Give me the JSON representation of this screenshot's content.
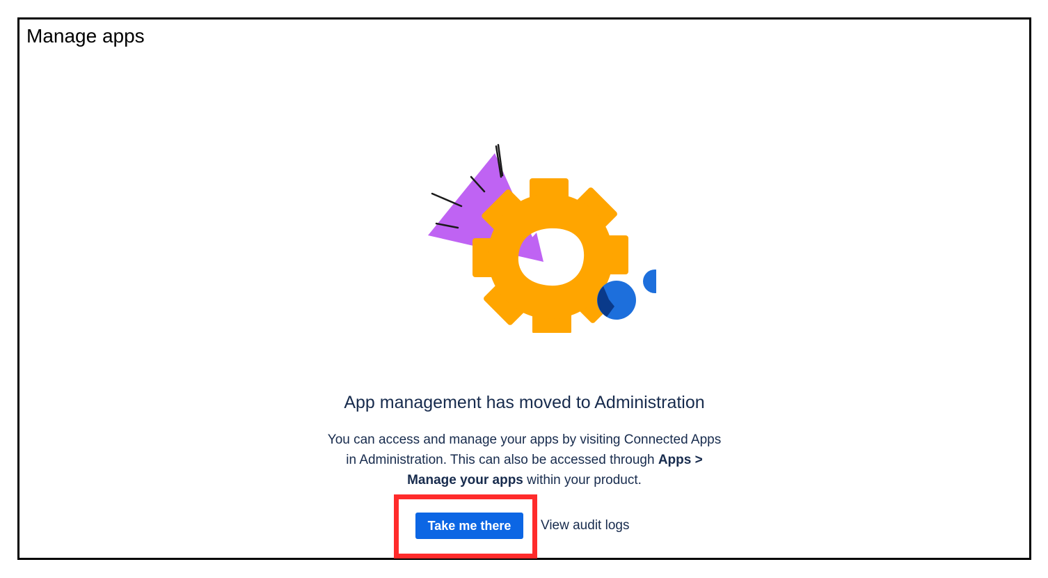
{
  "page": {
    "title": "Manage apps"
  },
  "main": {
    "headline": "App management has moved to Administration",
    "description_line1": "You can access and manage your apps by visiting Connected Apps",
    "description_line2_prefix": "in Administration. This can also be accessed through ",
    "description_line2_bold": "Apps >",
    "description_line3_bold": "Manage your apps",
    "description_line3_suffix": " within your product.",
    "primary_button_label": "Take me there",
    "secondary_link_label": "View audit logs"
  },
  "illustration": {
    "icon": "gear-illustration",
    "colors": {
      "gear": "#ffa500",
      "triangle": "#bf63f3",
      "dot": "#1d6fdc",
      "dot_overlap": "#0a3a8a",
      "strokes": "#1a1a1a"
    }
  },
  "annotation": {
    "highlight_color": "#ff2b2b"
  },
  "colors": {
    "primary": "#0c66e4",
    "text": "#172b4d",
    "frame_border": "#000000"
  }
}
